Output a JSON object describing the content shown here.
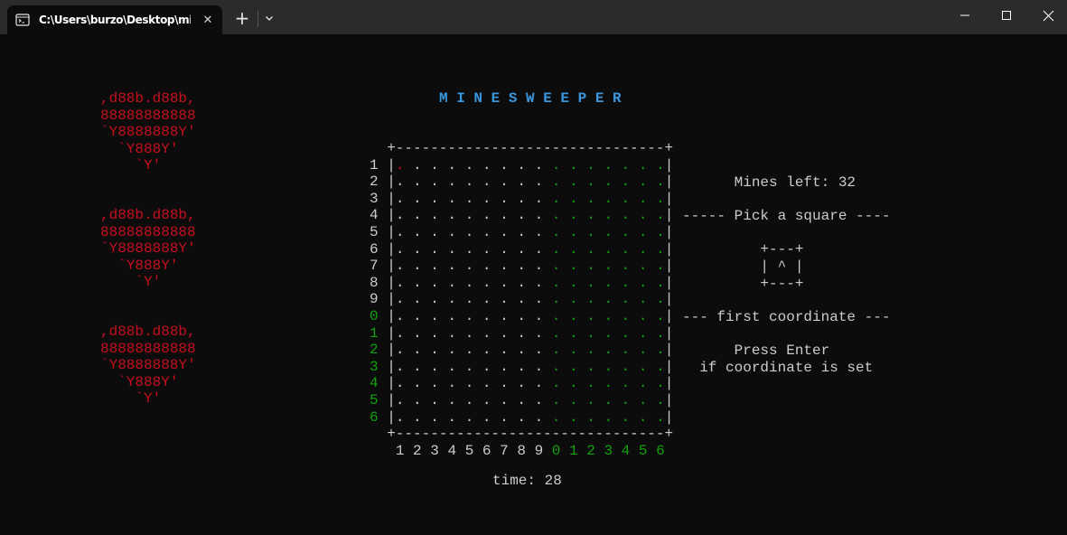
{
  "window": {
    "tab_title": "C:\\Users\\burzo\\Desktop\\mine",
    "tab_close": "✕",
    "new_tab": "+",
    "colors": {
      "titlebar": "#2b2b2b",
      "terminal_bg": "#0c0c0c"
    }
  },
  "game": {
    "title": "M I N E S W E E P E R",
    "colors": {
      "text": "#cccccc",
      "title": "#3a96dd",
      "hearts": "#c50f1f",
      "green": "#13a10e",
      "cursor": "#c50f1f"
    },
    "hearts": [
      [
        ",d88b.d88b,",
        "88888888888",
        "`Y8888888Y'",
        "  `Y888Y'",
        "    `Y'"
      ],
      [
        ",d88b.d88b,",
        "88888888888",
        "`Y8888888Y'",
        "  `Y888Y'",
        "    `Y'"
      ],
      [
        ",d88b.d88b,",
        "88888888888",
        "`Y8888888Y'",
        "  `Y888Y'",
        "    `Y'"
      ]
    ],
    "board": {
      "rows": 16,
      "cols": 16,
      "border": "+-------------------------------+",
      "cell": ".",
      "cursor": {
        "row": 1,
        "col": 1
      },
      "row_labels": [
        "1",
        "2",
        "3",
        "4",
        "5",
        "6",
        "7",
        "8",
        "9",
        "0",
        "1",
        "2",
        "3",
        "4",
        "5",
        "6"
      ],
      "col_labels": [
        "1",
        "2",
        "3",
        "4",
        "5",
        "6",
        "7",
        "8",
        "9",
        "0",
        "1",
        "2",
        "3",
        "4",
        "5",
        "6"
      ]
    },
    "side_panel": {
      "mines_left": "Mines left: 32",
      "pick_header": "----- Pick a square ----",
      "selector": [
        "+---+",
        "| ^ |",
        "+---+"
      ],
      "coordinate_header": "--- first coordinate ---",
      "hint": [
        "Press Enter",
        "if coordinate is set"
      ]
    },
    "time": "time: 28"
  }
}
